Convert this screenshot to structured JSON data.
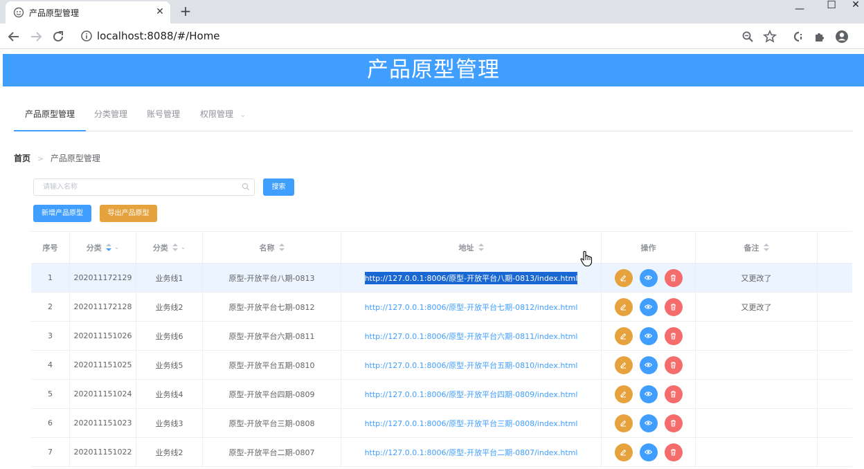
{
  "browser": {
    "tab_title": "产品原型管理",
    "url": "localhost:8088/#/Home",
    "close_glyph": "✕",
    "new_tab_glyph": "+",
    "minimize_glyph": "—",
    "maximize_glyph": "☐",
    "window_close_glyph": "✕"
  },
  "header": {
    "title": "产品原型管理"
  },
  "menu": {
    "items": [
      {
        "label": "产品原型管理",
        "active": true
      },
      {
        "label": "分类管理"
      },
      {
        "label": "账号管理"
      },
      {
        "label": "权限管理",
        "has_submenu": true
      }
    ],
    "submenu_glyph": "⌄"
  },
  "breadcrumb": {
    "home": "首页",
    "separator": ">",
    "current": "产品原型管理"
  },
  "search": {
    "placeholder": "请输入名称",
    "value": "",
    "button_label": "搜索"
  },
  "actions": {
    "add_label": "新增产品原型",
    "export_label": "导出产品原型"
  },
  "table": {
    "columns": [
      {
        "label": "序号"
      },
      {
        "label": "分类",
        "sort": "asc",
        "filter": true
      },
      {
        "label": "分类",
        "sort": "none",
        "filter": true
      },
      {
        "label": "名称",
        "sort": "none"
      },
      {
        "label": "地址",
        "sort": "none"
      },
      {
        "label": "操作"
      },
      {
        "label": "备注",
        "sort": "none"
      }
    ],
    "filter_glyph": "⌄",
    "rows": [
      {
        "index": "1",
        "code": "202011172129",
        "line": "业务线1",
        "name": "原型-开放平台八期-0813",
        "url": "http://127.0.0.1:8006/原型-开放平台八期-0813/index.html",
        "note": "又更改了",
        "highlighted": true,
        "url_selected": true
      },
      {
        "index": "2",
        "code": "202011172128",
        "line": "业务线2",
        "name": "原型-开放平台七期-0812",
        "url": "http://127.0.0.1:8006/原型-开放平台七期-0812/index.html",
        "note": "又更改了"
      },
      {
        "index": "3",
        "code": "202011151026",
        "line": "业务线6",
        "name": "原型-开放平台六期-0811",
        "url": "http://127.0.0.1:8006/原型-开放平台六期-0811/index.html",
        "note": ""
      },
      {
        "index": "4",
        "code": "202011151025",
        "line": "业务线5",
        "name": "原型-开放平台五期-0810",
        "url": "http://127.0.0.1:8006/原型-开放平台五期-0810/index.html",
        "note": ""
      },
      {
        "index": "5",
        "code": "202011151024",
        "line": "业务线4",
        "name": "原型-开放平台四期-0809",
        "url": "http://127.0.0.1:8006/原型-开放平台四期-0809/index.html",
        "note": ""
      },
      {
        "index": "6",
        "code": "202011151023",
        "line": "业务线3",
        "name": "原型-开放平台三期-0808",
        "url": "http://127.0.0.1:8006/原型-开放平台三期-0808/index.html",
        "note": ""
      },
      {
        "index": "7",
        "code": "202011151022",
        "line": "业务线2",
        "name": "原型-开放平台二期-0807",
        "url": "http://127.0.0.1:8006/原型-开放平台二期-0807/index.html",
        "note": ""
      }
    ]
  },
  "colors": {
    "primary": "#409eff",
    "warning": "#e6a23c",
    "danger": "#f56c6c",
    "highlight_row": "#ecf5ff"
  }
}
